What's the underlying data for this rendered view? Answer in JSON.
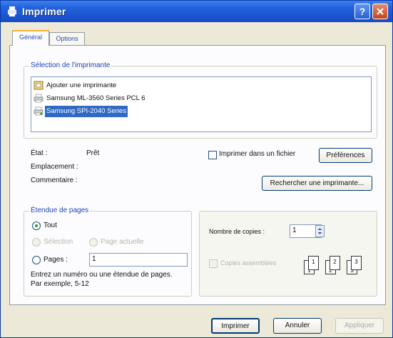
{
  "window": {
    "title": "Imprimer",
    "help": "?"
  },
  "tabs": [
    {
      "label": "Général"
    },
    {
      "label": "Options"
    }
  ],
  "printer_selection": {
    "legend": "Sélection de l'imprimante",
    "printers": [
      {
        "label": "Ajouter une imprimante",
        "icon": "add-printer-icon"
      },
      {
        "label": "Samsung ML-3560 Series PCL 6",
        "icon": "printer-icon"
      },
      {
        "label": "Samsung SPI-2040 Series",
        "icon": "printer-icon",
        "selected": true
      }
    ]
  },
  "status": {
    "state_label": "État :",
    "state_value": "Prêt",
    "location_label": "Emplacement :",
    "comment_label": "Commentaire :",
    "print_to_file_label": "Imprimer dans un fichier",
    "preferences_button": "Préférences",
    "find_printer_button": "Rechercher une imprimante..."
  },
  "page_range": {
    "legend": "Étendue de pages",
    "all_label": "Tout",
    "selection_label": "Sélection",
    "current_page_label": "Page actuelle",
    "pages_label": "Pages :",
    "pages_value": "1",
    "hint_line1": "Entrez un numéro ou une étendue de pages.",
    "hint_line2": "Par exemple, 5-12"
  },
  "copies": {
    "count_label": "Nombre de copies :",
    "count_value": "1",
    "collate_label": "Copies assemblées",
    "collate_pages": [
      "1",
      "1",
      "2",
      "2",
      "3",
      "3"
    ]
  },
  "footer": {
    "print_button": "Imprimer",
    "cancel_button": "Annuler",
    "apply_button": "Appliquer"
  },
  "colors": {
    "titlebar": "#2463dc",
    "legend_text": "#2047b8",
    "selection": "#316ac5"
  }
}
